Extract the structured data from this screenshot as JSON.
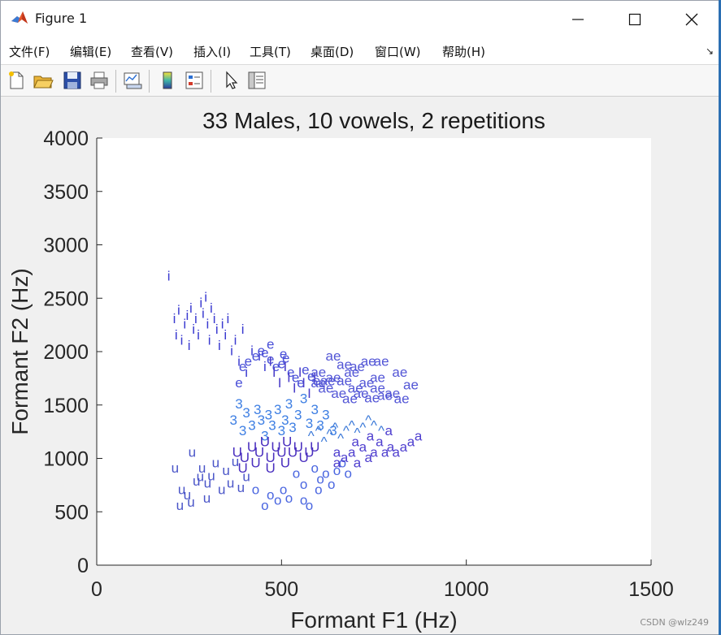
{
  "window": {
    "title": "Figure 1",
    "watermark": "CSDN @wlz249"
  },
  "menu": [
    {
      "label": "文件(F)",
      "name": "menu-file"
    },
    {
      "label": "编辑(E)",
      "name": "menu-edit"
    },
    {
      "label": "查看(V)",
      "name": "menu-view"
    },
    {
      "label": "插入(I)",
      "name": "menu-insert"
    },
    {
      "label": "工具(T)",
      "name": "menu-tools"
    },
    {
      "label": "桌面(D)",
      "name": "menu-desktop"
    },
    {
      "label": "窗口(W)",
      "name": "menu-window"
    },
    {
      "label": "帮助(H)",
      "name": "menu-help"
    }
  ],
  "toolbar": [
    {
      "icon": "new-figure-icon"
    },
    {
      "icon": "open-file-icon"
    },
    {
      "icon": "save-icon"
    },
    {
      "icon": "print-icon"
    },
    {
      "icon": "link-plot-icon"
    },
    {
      "icon": "colorbar-icon"
    },
    {
      "icon": "legend-icon"
    },
    {
      "icon": "pointer-icon"
    },
    {
      "icon": "property-inspector-icon"
    }
  ],
  "chart_data": {
    "type": "scatter",
    "title": "33 Males, 10 vowels, 2 repetitions",
    "xlabel": "Formant F1 (Hz)",
    "ylabel": "Formant F2 (Hz)",
    "xlim": [
      0,
      1500
    ],
    "ylim": [
      0,
      4000
    ],
    "xticks": [
      0,
      500,
      1000,
      1500
    ],
    "yticks": [
      0,
      500,
      1000,
      1500,
      2000,
      2500,
      3000,
      3500,
      4000
    ],
    "grid": false,
    "marker_style": "text",
    "series": [
      {
        "label": "i",
        "color": "#3a3ad0",
        "points": [
          [
            195,
            2700
          ],
          [
            210,
            2300
          ],
          [
            215,
            2150
          ],
          [
            222,
            2380
          ],
          [
            230,
            2100
          ],
          [
            238,
            2250
          ],
          [
            245,
            2330
          ],
          [
            250,
            2050
          ],
          [
            255,
            2400
          ],
          [
            262,
            2200
          ],
          [
            268,
            2300
          ],
          [
            275,
            2150
          ],
          [
            282,
            2450
          ],
          [
            288,
            2350
          ],
          [
            295,
            2500
          ],
          [
            300,
            2250
          ],
          [
            305,
            2100
          ],
          [
            310,
            2400
          ],
          [
            318,
            2300
          ],
          [
            325,
            2200
          ],
          [
            332,
            2050
          ],
          [
            340,
            2250
          ],
          [
            348,
            2150
          ],
          [
            355,
            2300
          ],
          [
            365,
            2000
          ],
          [
            375,
            2100
          ],
          [
            385,
            1900
          ],
          [
            395,
            2200
          ],
          [
            405,
            1800
          ],
          [
            420,
            2000
          ],
          [
            440,
            1950
          ],
          [
            455,
            1850
          ]
        ]
      },
      {
        "label": "e",
        "color": "#4a50d8",
        "points": [
          [
            385,
            1700
          ],
          [
            395,
            1850
          ],
          [
            410,
            1900
          ],
          [
            430,
            1950
          ],
          [
            445,
            2000
          ],
          [
            455,
            1980
          ],
          [
            470,
            1920
          ],
          [
            485,
            1850
          ],
          [
            500,
            1880
          ],
          [
            512,
            1930
          ],
          [
            525,
            1800
          ],
          [
            538,
            1750
          ],
          [
            552,
            1700
          ],
          [
            565,
            1820
          ],
          [
            580,
            1760
          ],
          [
            595,
            1720
          ],
          [
            470,
            2060
          ],
          [
            505,
            1970
          ]
        ]
      },
      {
        "label": "I",
        "color": "#4b3ec9",
        "points": [
          [
            470,
            1900
          ],
          [
            480,
            1800
          ],
          [
            495,
            1700
          ],
          [
            510,
            1850
          ],
          [
            520,
            1750
          ],
          [
            535,
            1650
          ],
          [
            550,
            1800
          ],
          [
            560,
            1700
          ],
          [
            575,
            1600
          ],
          [
            590,
            1750
          ]
        ]
      },
      {
        "label": "ae",
        "color": "#5356d6",
        "points": [
          [
            600,
            1700
          ],
          [
            620,
            1650
          ],
          [
            640,
            1750
          ],
          [
            655,
            1600
          ],
          [
            670,
            1720
          ],
          [
            685,
            1550
          ],
          [
            700,
            1650
          ],
          [
            715,
            1600
          ],
          [
            730,
            1700
          ],
          [
            745,
            1560
          ],
          [
            760,
            1650
          ],
          [
            780,
            1580
          ],
          [
            800,
            1600
          ],
          [
            825,
            1550
          ],
          [
            850,
            1680
          ],
          [
            640,
            1950
          ],
          [
            670,
            1870
          ],
          [
            705,
            1850
          ],
          [
            735,
            1900
          ],
          [
            770,
            1900
          ],
          [
            820,
            1800
          ],
          [
            600,
            1800
          ],
          [
            625,
            1720
          ],
          [
            690,
            1800
          ],
          [
            760,
            1750
          ]
        ]
      },
      {
        "label": "3",
        "color": "#3e7fe3",
        "points": [
          [
            370,
            1350
          ],
          [
            385,
            1500
          ],
          [
            395,
            1250
          ],
          [
            405,
            1420
          ],
          [
            420,
            1300
          ],
          [
            435,
            1450
          ],
          [
            445,
            1350
          ],
          [
            455,
            1200
          ],
          [
            465,
            1400
          ],
          [
            475,
            1300
          ],
          [
            490,
            1450
          ],
          [
            500,
            1250
          ],
          [
            510,
            1350
          ],
          [
            520,
            1500
          ],
          [
            530,
            1280
          ],
          [
            545,
            1400
          ],
          [
            560,
            1550
          ],
          [
            575,
            1320
          ],
          [
            590,
            1450
          ],
          [
            605,
            1300
          ],
          [
            620,
            1400
          ],
          [
            640,
            1250
          ]
        ]
      },
      {
        "label": "^",
        "color": "#3a78d8",
        "points": [
          [
            580,
            1200
          ],
          [
            600,
            1250
          ],
          [
            615,
            1150
          ],
          [
            630,
            1220
          ],
          [
            645,
            1280
          ],
          [
            660,
            1180
          ],
          [
            675,
            1250
          ],
          [
            690,
            1300
          ],
          [
            705,
            1230
          ],
          [
            720,
            1280
          ],
          [
            735,
            1350
          ],
          [
            750,
            1300
          ],
          [
            770,
            1250
          ]
        ]
      },
      {
        "label": "U",
        "color": "#4a2fbf",
        "points": [
          [
            380,
            1050
          ],
          [
            400,
            1000
          ],
          [
            420,
            1100
          ],
          [
            440,
            1050
          ],
          [
            455,
            1150
          ],
          [
            470,
            1000
          ],
          [
            485,
            1100
          ],
          [
            500,
            1050
          ],
          [
            515,
            1150
          ],
          [
            530,
            1050
          ],
          [
            545,
            1100
          ],
          [
            560,
            1000
          ],
          [
            575,
            1050
          ],
          [
            590,
            1100
          ],
          [
            430,
            950
          ],
          [
            470,
            900
          ],
          [
            510,
            950
          ],
          [
            395,
            900
          ]
        ]
      },
      {
        "label": "u",
        "color": "#4a55c8",
        "points": [
          [
            230,
            700
          ],
          [
            245,
            650
          ],
          [
            258,
            1050
          ],
          [
            270,
            780
          ],
          [
            285,
            900
          ],
          [
            298,
            620
          ],
          [
            310,
            830
          ],
          [
            322,
            950
          ],
          [
            338,
            700
          ],
          [
            350,
            880
          ],
          [
            362,
            760
          ],
          [
            375,
            960
          ],
          [
            390,
            720
          ],
          [
            405,
            820
          ],
          [
            212,
            900
          ],
          [
            225,
            550
          ],
          [
            255,
            580
          ],
          [
            280,
            820
          ],
          [
            300,
            760
          ]
        ]
      },
      {
        "label": "o",
        "color": "#4a66e0",
        "points": [
          [
            430,
            700
          ],
          [
            455,
            550
          ],
          [
            470,
            650
          ],
          [
            490,
            600
          ],
          [
            505,
            700
          ],
          [
            520,
            620
          ],
          [
            540,
            850
          ],
          [
            560,
            750
          ],
          [
            575,
            550
          ],
          [
            590,
            900
          ],
          [
            605,
            800
          ],
          [
            620,
            850
          ],
          [
            635,
            750
          ],
          [
            650,
            880
          ],
          [
            665,
            950
          ],
          [
            680,
            850
          ],
          [
            560,
            600
          ],
          [
            600,
            700
          ]
        ]
      },
      {
        "label": "a",
        "color": "#4f3fcf",
        "points": [
          [
            650,
            950
          ],
          [
            670,
            1000
          ],
          [
            690,
            1050
          ],
          [
            705,
            950
          ],
          [
            720,
            1100
          ],
          [
            735,
            1000
          ],
          [
            750,
            1050
          ],
          [
            765,
            1150
          ],
          [
            780,
            1050
          ],
          [
            795,
            1100
          ],
          [
            810,
            1050
          ],
          [
            830,
            1100
          ],
          [
            850,
            1150
          ],
          [
            870,
            1200
          ],
          [
            700,
            1150
          ],
          [
            740,
            1200
          ],
          [
            790,
            1250
          ],
          [
            650,
            1050
          ]
        ]
      }
    ]
  }
}
